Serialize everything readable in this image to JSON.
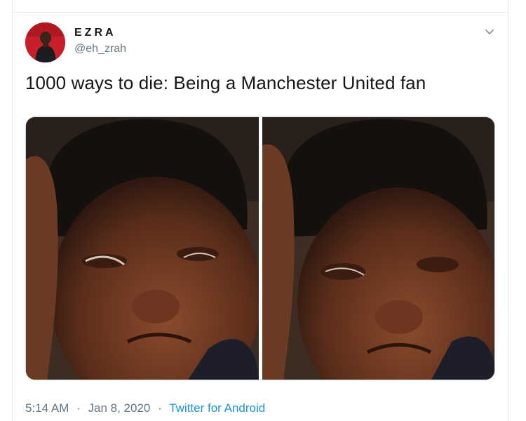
{
  "tweet": {
    "author_name": "EZRA",
    "author_handle": "@eh_zrah",
    "text": "1000 ways to die: Being a Manchester United fan",
    "time": "5:14 AM",
    "date": "Jan 8, 2020",
    "separator": "·",
    "source": "Twitter for Android"
  },
  "icons": {
    "caret": "chevron-down-icon",
    "avatar": "avatar-photo"
  },
  "colors": {
    "text_primary": "#14171a",
    "text_secondary": "#657786",
    "link": "#1b95e0",
    "avatar_bg": "#c8202b",
    "border": "#e6ecf0"
  }
}
